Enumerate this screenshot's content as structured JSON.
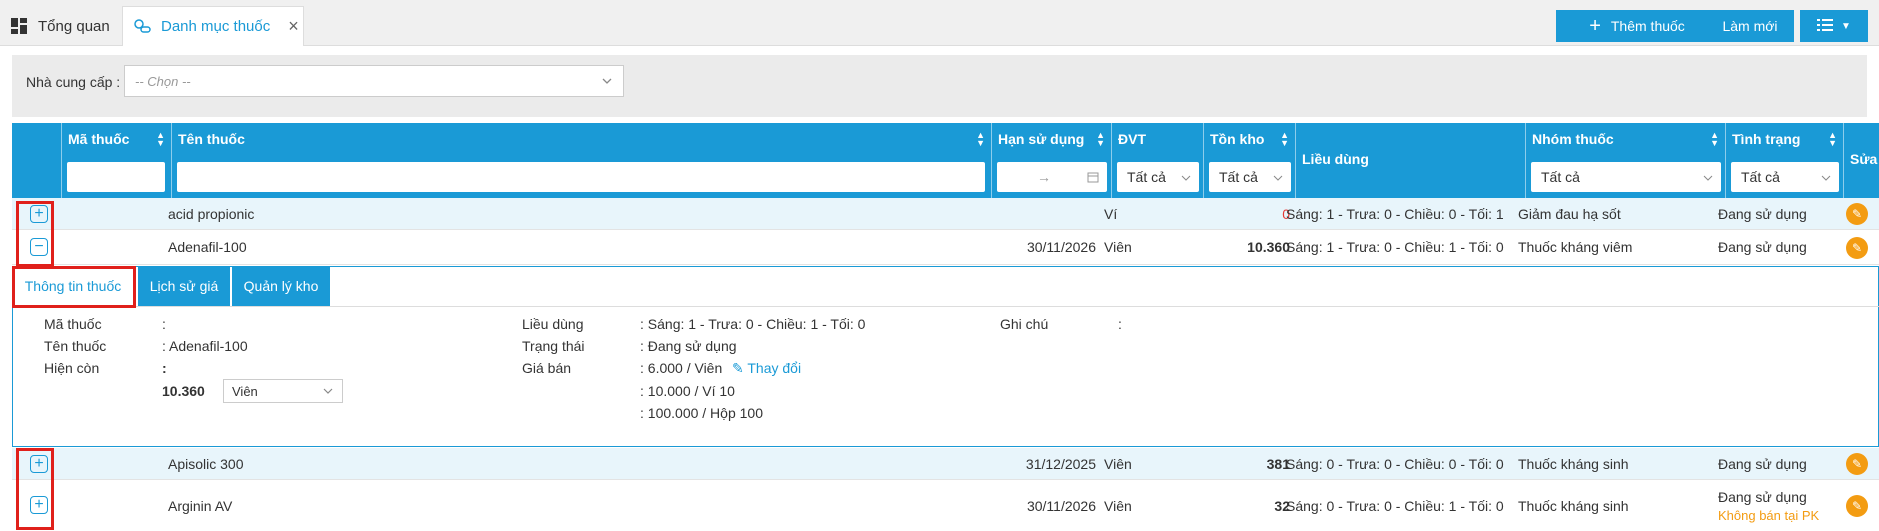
{
  "tabs": [
    {
      "label": "Tổng quan"
    },
    {
      "label": "Danh mục thuốc"
    }
  ],
  "filter": {
    "supplier_label": "Nhà cung cấp :",
    "supplier_placeholder": "-- Chọn --",
    "add_label": "Thêm thuốc",
    "refresh_label": "Làm mới"
  },
  "columns": {
    "code": "Mã thuốc",
    "name": "Tên thuốc",
    "expiry": "Hạn sử dụng",
    "unit": "ĐVT",
    "stock": "Tồn kho",
    "dosage": "Liều dùng",
    "group": "Nhóm thuốc",
    "status": "Tình trạng",
    "edit": "Sửa",
    "filter_all": "Tất cả",
    "date_arrow": "→"
  },
  "rows": [
    {
      "name": "acid propionic",
      "expiry": "",
      "unit": "Ví",
      "stock": "0",
      "dosage": "Sáng: 1 - Trưa: 0 - Chiều: 0 - Tối: 1",
      "group": "Giảm đau hạ sốt",
      "status": "Đang sử dụng",
      "status2": ""
    },
    {
      "name": "Adenafil-100",
      "expiry": "30/11/2026",
      "unit": "Viên",
      "stock": "10.360",
      "dosage": "Sáng: 1 - Trưa: 0 - Chiều: 1 - Tối: 0",
      "group": "Thuốc kháng viêm",
      "status": "Đang sử dụng",
      "status2": ""
    },
    {
      "name": "Apisolic 300",
      "expiry": "31/12/2025",
      "unit": "Viên",
      "stock": "381",
      "dosage": "Sáng: 0 - Trưa: 0 - Chiều: 0 - Tối: 0",
      "group": "Thuốc kháng sinh",
      "status": "Đang sử dụng",
      "status2": ""
    },
    {
      "name": "Arginin AV",
      "expiry": "30/11/2026",
      "unit": "Viên",
      "stock": "32",
      "dosage": "Sáng: 0 - Trưa: 0 - Chiều: 1 - Tối: 0",
      "group": "Thuốc kháng sinh",
      "status": "Đang sử dụng",
      "status2": "Không bán tại PK"
    }
  ],
  "detail": {
    "tabs": [
      "Thông tin thuốc",
      "Lịch sử giá",
      "Quản lý kho"
    ],
    "code_label": "Mã thuốc",
    "code_value": ":",
    "name_label": "Tên thuốc",
    "name_value": ": Adenafil-100",
    "remain_label": "Hiện còn",
    "remain_colon": ":",
    "remain_qty": "10.360",
    "remain_unit": "Viên",
    "dosage_label": "Liều dùng",
    "dosage_value": ": Sáng: 1 - Trưa: 0 - Chiều: 1 - Tối: 0",
    "status_label": "Trạng thái",
    "status_value": ": Đang sử dụng",
    "price_label": "Giá bán",
    "prices": [
      ": 6.000 / Viên",
      ": 10.000 / Ví 10",
      ": 100.000 / Hộp 100"
    ],
    "change_label": "Thay đổi",
    "note_label": "Ghi chú",
    "note_value": ":"
  },
  "colors": {
    "accent": "#1a9ad6",
    "edit": "#f39c12",
    "danger": "#e53935",
    "highlight": "#e0201b"
  }
}
